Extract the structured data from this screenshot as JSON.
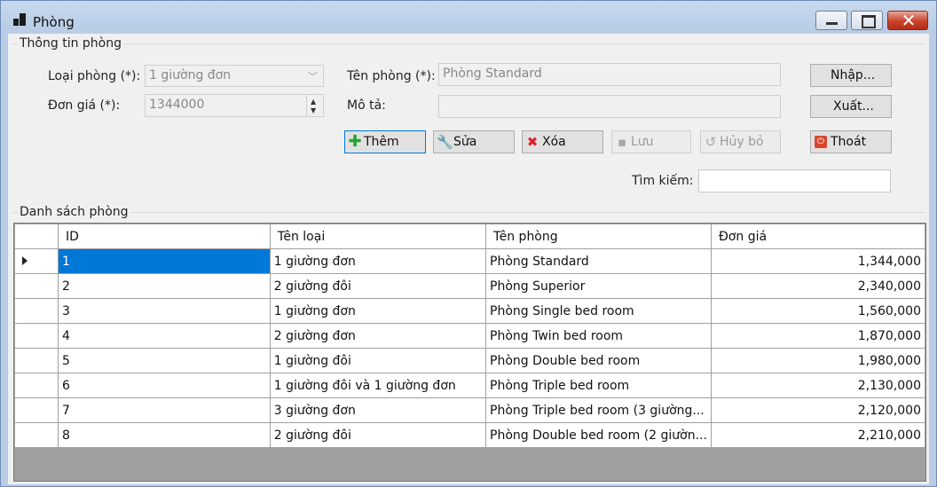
{
  "window": {
    "title": "Phòng"
  },
  "info_group": {
    "label": "Thông tin phòng"
  },
  "form": {
    "room_type_label": "Loại phòng (*):",
    "room_type_value": "1 giường đơn",
    "price_label": "Đơn giá (*):",
    "price_value": "1344000",
    "room_name_label": "Tên phòng (*):",
    "room_name_value": "Phòng Standard",
    "description_label": "Mô tả:",
    "description_value": ""
  },
  "buttons": {
    "import": "Nhập...",
    "export": "Xuất...",
    "add": "Thêm",
    "edit": "Sửa",
    "delete": "Xóa",
    "save": "Lưu",
    "cancel": "Hủy bỏ",
    "exit": "Thoát"
  },
  "search": {
    "label": "Tìm kiếm:",
    "value": ""
  },
  "list_group": {
    "label": "Danh sách phòng"
  },
  "table": {
    "columns": [
      "ID",
      "Tên loại",
      "Tên phòng",
      "Đơn giá"
    ],
    "selected_row": 0,
    "rows": [
      [
        "1",
        "1 giường đơn",
        "Phòng Standard",
        "1,344,000"
      ],
      [
        "2",
        "2 giường đôi",
        "Phòng Superior",
        "2,340,000"
      ],
      [
        "3",
        "1 giường đơn",
        "Phòng Single bed room",
        "1,560,000"
      ],
      [
        "4",
        "2 giường đơn",
        "Phòng Twin bed room",
        "1,870,000"
      ],
      [
        "5",
        "1 giường đôi",
        "Phòng Double bed room",
        "1,980,000"
      ],
      [
        "6",
        "1 giường đôi và 1 giường đơn",
        "Phòng Triple bed room",
        "2,130,000"
      ],
      [
        "7",
        "3 giường đơn",
        "Phòng Triple bed room (3 giường...",
        "2,120,000"
      ],
      [
        "8",
        "2 giường đôi",
        "Phòng Double bed room (2 giườn...",
        "2,210,000"
      ]
    ]
  },
  "colors": {
    "selection": "#0078d7",
    "focus_border": "#0078d7",
    "add_icon": "#22a52f",
    "delete_icon": "#d8262b",
    "exit_icon": "#d9452b"
  },
  "icons": {
    "add": "plus-icon",
    "edit": "wrench-icon",
    "delete": "x-icon",
    "save": "floppy-icon",
    "cancel": "undo-icon",
    "exit": "power-icon"
  }
}
